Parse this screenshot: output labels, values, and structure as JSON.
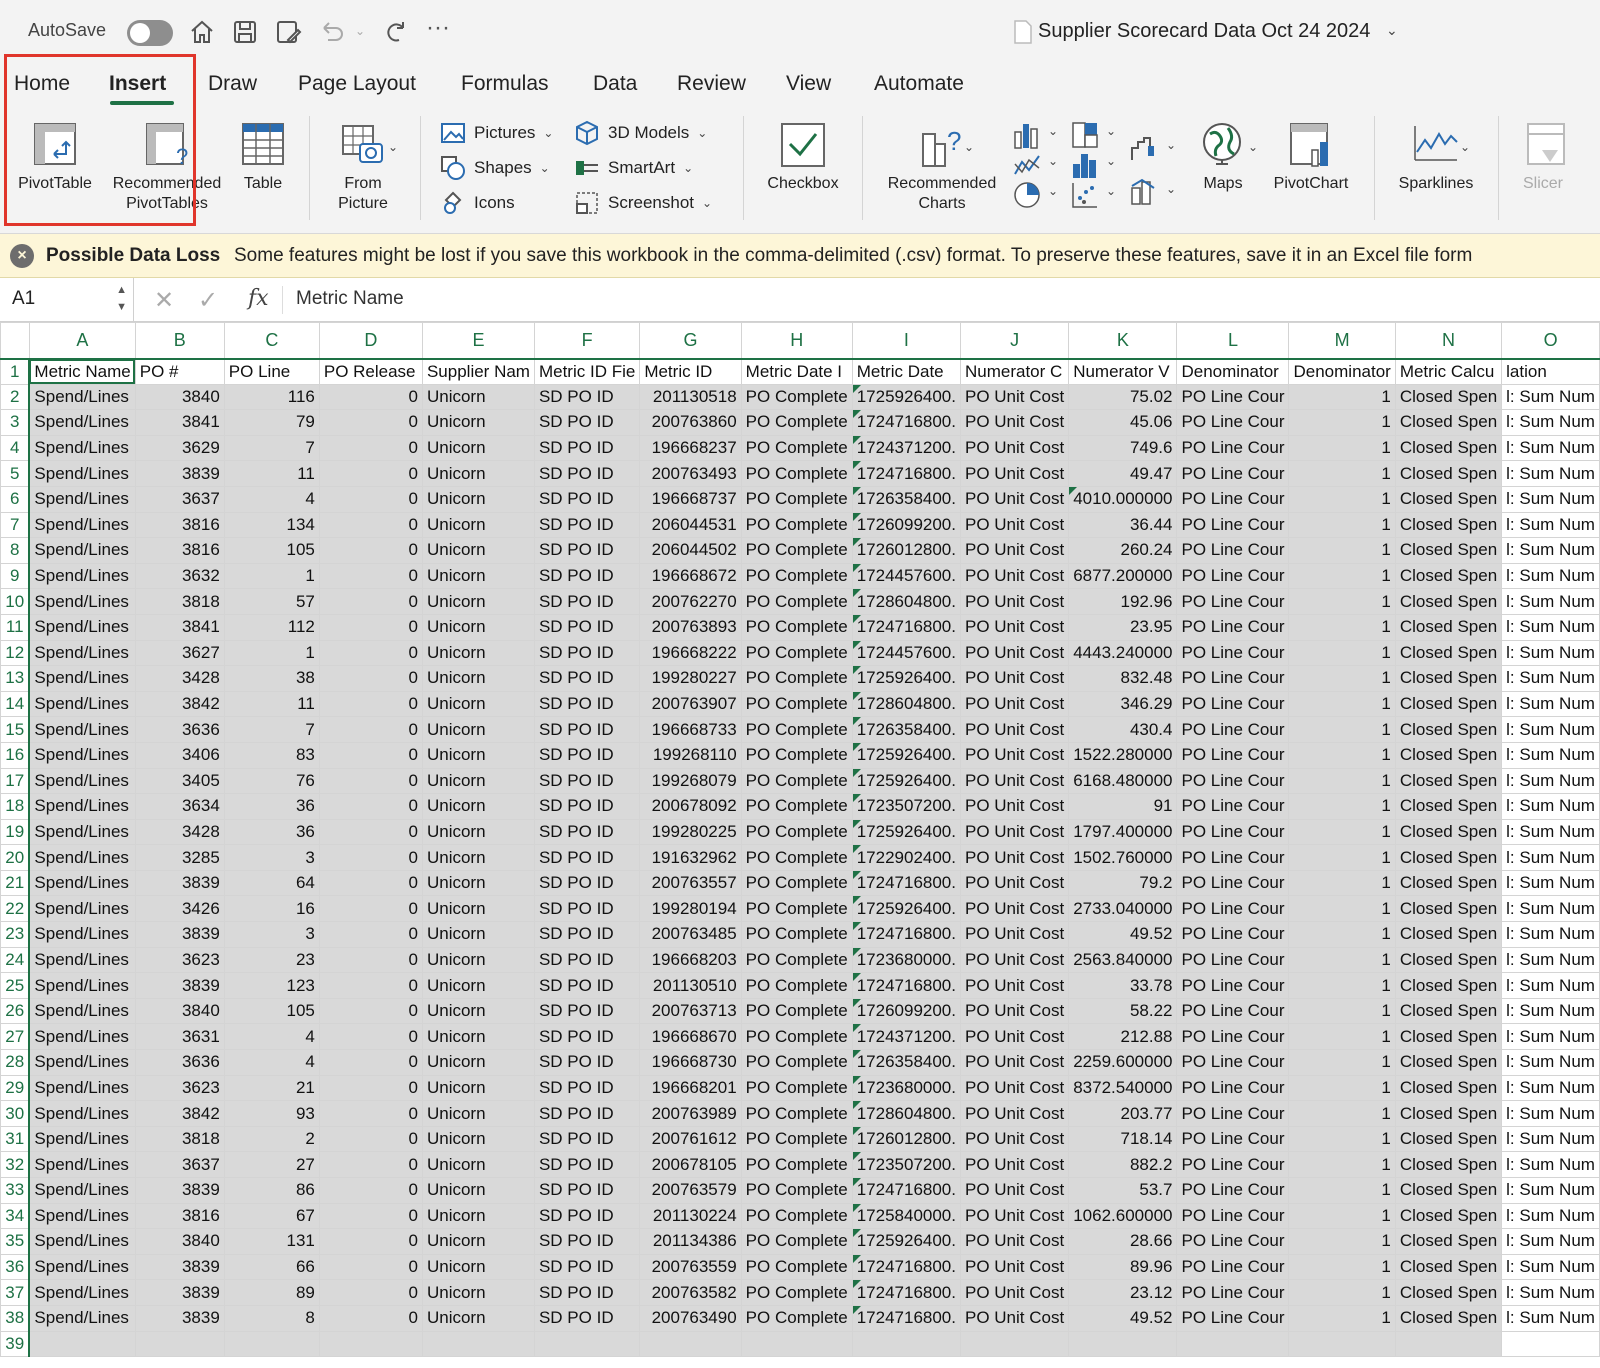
{
  "titlebar": {
    "autosave_label": "AutoSave",
    "autosave_state": "off",
    "document_title": "Supplier Scorecard Data Oct 24 2024"
  },
  "tabs": [
    "Home",
    "Insert",
    "Draw",
    "Page Layout",
    "Formulas",
    "Data",
    "Review",
    "View",
    "Automate"
  ],
  "active_tab": "Insert",
  "ribbon": {
    "pivottable": "PivotTable",
    "recommended_pivottables_1": "Recommended",
    "recommended_pivottables_2": "PivotTables",
    "table": "Table",
    "from_picture_1": "From",
    "from_picture_2": "Picture",
    "pictures": "Pictures",
    "shapes": "Shapes",
    "icons": "Icons",
    "models_3d": "3D Models",
    "smartart": "SmartArt",
    "screenshot": "Screenshot",
    "checkbox": "Checkbox",
    "recommended_charts_1": "Recommended",
    "recommended_charts_2": "Charts",
    "maps": "Maps",
    "pivotchart": "PivotChart",
    "sparklines": "Sparklines",
    "slicer": "Slicer"
  },
  "message_bar": {
    "title": "Possible Data Loss",
    "text": "Some features might be lost if you save this workbook in the comma-delimited (.csv) format. To preserve these features, save it in an Excel file form"
  },
  "formula_bar": {
    "name_box": "A1",
    "fx": "fx",
    "value": "Metric Name"
  },
  "sheet": {
    "column_letters": [
      "A",
      "B",
      "C",
      "D",
      "E",
      "F",
      "G",
      "H",
      "I",
      "J",
      "K",
      "L",
      "M",
      "N",
      "O"
    ],
    "header_row": [
      "Metric Name",
      "PO #",
      "PO Line",
      "PO Release",
      "Supplier Nam",
      "Metric ID Fie",
      "Metric ID",
      "Metric Date I",
      "Metric Date",
      "Numerator C",
      "Numerator V",
      "Denominator",
      "Denominator",
      "Metric Calcu",
      "lation"
    ],
    "row_constants": {
      "metric_name": "Spend/Lines",
      "po_release": "0",
      "supplier": "Unicorn",
      "metric_id_field": "SD PO ID",
      "metric_date_type": "PO Complete",
      "numerator_col": "PO Unit Cost",
      "denominator_col": "PO Line Cour",
      "denominator_val": "1",
      "metric_calc": "Closed Spen",
      "calc_overflow": "l: Sum Num"
    },
    "rows": [
      [
        "3840",
        "116",
        "201130518",
        "1725926400.",
        "75.02"
      ],
      [
        "3841",
        "79",
        "200763860",
        "1724716800.",
        "45.06"
      ],
      [
        "3629",
        "7",
        "196668237",
        "1724371200.",
        "749.6"
      ],
      [
        "3839",
        "11",
        "200763493",
        "1724716800.",
        "49.47"
      ],
      [
        "3637",
        "4",
        "196668737",
        "1726358400.",
        "4010.000000"
      ],
      [
        "3816",
        "134",
        "206044531",
        "1726099200.",
        "36.44"
      ],
      [
        "3816",
        "105",
        "206044502",
        "1726012800.",
        "260.24"
      ],
      [
        "3632",
        "1",
        "196668672",
        "1724457600.",
        "6877.200000"
      ],
      [
        "3818",
        "57",
        "200762270",
        "1728604800.",
        "192.96"
      ],
      [
        "3841",
        "112",
        "200763893",
        "1724716800.",
        "23.95"
      ],
      [
        "3627",
        "1",
        "196668222",
        "1724457600.",
        "4443.240000"
      ],
      [
        "3428",
        "38",
        "199280227",
        "1725926400.",
        "832.48"
      ],
      [
        "3842",
        "11",
        "200763907",
        "1728604800.",
        "346.29"
      ],
      [
        "3636",
        "7",
        "196668733",
        "1726358400.",
        "430.4"
      ],
      [
        "3406",
        "83",
        "199268110",
        "1725926400.",
        "1522.280000"
      ],
      [
        "3405",
        "76",
        "199268079",
        "1725926400.",
        "6168.480000"
      ],
      [
        "3634",
        "36",
        "200678092",
        "1723507200.",
        "91"
      ],
      [
        "3428",
        "36",
        "199280225",
        "1725926400.",
        "1797.400000"
      ],
      [
        "3285",
        "3",
        "191632962",
        "1722902400.",
        "1502.760000"
      ],
      [
        "3839",
        "64",
        "200763557",
        "1724716800.",
        "79.2"
      ],
      [
        "3426",
        "16",
        "199280194",
        "1725926400.",
        "2733.040000"
      ],
      [
        "3839",
        "3",
        "200763485",
        "1724716800.",
        "49.52"
      ],
      [
        "3623",
        "23",
        "196668203",
        "1723680000.",
        "2563.840000"
      ],
      [
        "3839",
        "123",
        "201130510",
        "1724716800.",
        "33.78"
      ],
      [
        "3840",
        "105",
        "200763713",
        "1726099200.",
        "58.22"
      ],
      [
        "3631",
        "4",
        "196668670",
        "1724371200.",
        "212.88"
      ],
      [
        "3636",
        "4",
        "196668730",
        "1726358400.",
        "2259.600000"
      ],
      [
        "3623",
        "21",
        "196668201",
        "1723680000.",
        "8372.540000"
      ],
      [
        "3842",
        "93",
        "200763989",
        "1728604800.",
        "203.77"
      ],
      [
        "3818",
        "2",
        "200761612",
        "1726012800.",
        "718.14"
      ],
      [
        "3637",
        "27",
        "200678105",
        "1723507200.",
        "882.2"
      ],
      [
        "3839",
        "86",
        "200763579",
        "1724716800.",
        "53.7"
      ],
      [
        "3816",
        "67",
        "201130224",
        "1725840000.",
        "1062.600000"
      ],
      [
        "3840",
        "131",
        "201134386",
        "1725926400.",
        "28.66"
      ],
      [
        "3839",
        "66",
        "200763559",
        "1724716800.",
        "89.96"
      ],
      [
        "3839",
        "89",
        "200763582",
        "1724716800.",
        "23.12"
      ],
      [
        "3839",
        "8",
        "200763490",
        "1724716800.",
        "49.52"
      ]
    ],
    "last_row_number": "39"
  },
  "colors": {
    "excel_green": "#1e7145",
    "highlight_red": "#e0352b",
    "selection_gray": "#d9d9d9",
    "message_bg": "#fdf6d8"
  }
}
